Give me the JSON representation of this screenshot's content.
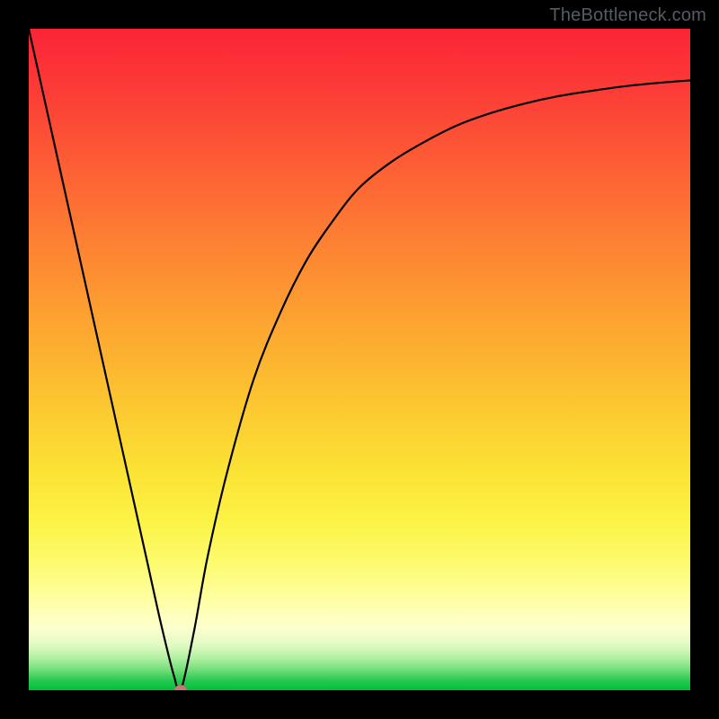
{
  "watermark": "TheBottleneck.com",
  "colors": {
    "frame": "#000000",
    "curve": "#000000",
    "marker": "#c17a74"
  },
  "chart_data": {
    "type": "line",
    "title": "",
    "xlabel": "",
    "ylabel": "",
    "xlim": [
      0,
      100
    ],
    "ylim": [
      0,
      100
    ],
    "grid": false,
    "legend": false,
    "series": [
      {
        "name": "bottleneck-curve",
        "x": [
          0,
          2,
          4,
          6,
          8,
          10,
          12,
          14,
          16,
          18,
          20,
          22,
          23,
          25,
          27,
          30,
          34,
          38,
          42,
          46,
          50,
          55,
          60,
          65,
          70,
          75,
          80,
          85,
          90,
          95,
          100
        ],
        "values": [
          100,
          91,
          82,
          73,
          64,
          55,
          46,
          37,
          28,
          19,
          10,
          2,
          0,
          9,
          20,
          33,
          47,
          57,
          65,
          71,
          76,
          80,
          83,
          85.5,
          87.3,
          88.7,
          89.8,
          90.6,
          91.3,
          91.8,
          92.2
        ]
      }
    ],
    "annotations": [
      {
        "name": "min-marker",
        "x": 23,
        "y": 0
      }
    ],
    "gradient_stops": [
      {
        "pos": 0.0,
        "color": "#fb2437"
      },
      {
        "pos": 0.5,
        "color": "#fdb830"
      },
      {
        "pos": 0.8,
        "color": "#fdfb71"
      },
      {
        "pos": 1.0,
        "color": "#00bf3a"
      }
    ]
  }
}
